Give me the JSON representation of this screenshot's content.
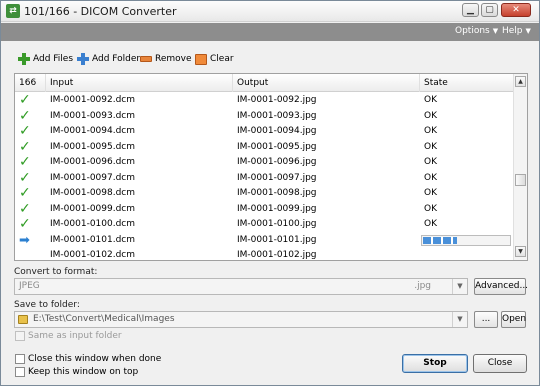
{
  "window": {
    "title": "101/166 - DICOM Converter",
    "app_icon_glyph": "⇄",
    "controls": {
      "minimize": "▁",
      "maximize": "▢",
      "close": "✕"
    }
  },
  "menu": {
    "items": [
      {
        "label": "Options",
        "caret": "▼"
      },
      {
        "label": "Help",
        "caret": "▼"
      }
    ]
  },
  "toolbar": {
    "add_files": "Add Files",
    "add_folder": "Add Folder",
    "remove": "Remove",
    "clear": "Clear"
  },
  "table": {
    "columns": [
      "166",
      "Input",
      "Output",
      "State"
    ],
    "rows": [
      {
        "status": "done",
        "icon": "✓",
        "input": "IM-0001-0092.dcm",
        "output": "IM-0001-0092.jpg",
        "state": "OK"
      },
      {
        "status": "done",
        "icon": "✓",
        "input": "IM-0001-0093.dcm",
        "output": "IM-0001-0093.jpg",
        "state": "OK"
      },
      {
        "status": "done",
        "icon": "✓",
        "input": "IM-0001-0094.dcm",
        "output": "IM-0001-0094.jpg",
        "state": "OK"
      },
      {
        "status": "done",
        "icon": "✓",
        "input": "IM-0001-0095.dcm",
        "output": "IM-0001-0095.jpg",
        "state": "OK"
      },
      {
        "status": "done",
        "icon": "✓",
        "input": "IM-0001-0096.dcm",
        "output": "IM-0001-0096.jpg",
        "state": "OK"
      },
      {
        "status": "done",
        "icon": "✓",
        "input": "IM-0001-0097.dcm",
        "output": "IM-0001-0097.jpg",
        "state": "OK"
      },
      {
        "status": "done",
        "icon": "✓",
        "input": "IM-0001-0098.dcm",
        "output": "IM-0001-0098.jpg",
        "state": "OK"
      },
      {
        "status": "done",
        "icon": "✓",
        "input": "IM-0001-0099.dcm",
        "output": "IM-0001-0099.jpg",
        "state": "OK"
      },
      {
        "status": "done",
        "icon": "✓",
        "input": "IM-0001-0100.dcm",
        "output": "IM-0001-0100.jpg",
        "state": "OK"
      },
      {
        "status": "processing",
        "icon": "➡",
        "input": "IM-0001-0101.dcm",
        "output": "IM-0001-0101.jpg",
        "state": "",
        "progress": 0.4
      },
      {
        "status": "pending",
        "icon": "",
        "input": "IM-0001-0102.dcm",
        "output": "IM-0001-0102.jpg",
        "state": ""
      }
    ],
    "scroll": {
      "up": "▲",
      "down": "▼"
    }
  },
  "convert": {
    "label": "Convert to format:",
    "format": "JPEG",
    "extension": ".jpg",
    "dropdown_glyph": "▼",
    "advanced_button": "Advanced..."
  },
  "save": {
    "label": "Save to folder:",
    "path": "E:\\Test\\Convert\\Medical\\Images",
    "dropdown_glyph": "▼",
    "browse_button": "...",
    "open_button": "Open",
    "same_as_input_label": "Same as input folder"
  },
  "footer": {
    "close_when_done_label": "Close this window when done",
    "keep_on_top_label": "Keep this window on top",
    "stop_button": "Stop",
    "close_button": "Close"
  },
  "colors": {
    "menubar": "#8d8d8d",
    "check": "#2e9b22",
    "progress": "#4a90d9",
    "close_button": "#c5412d"
  }
}
